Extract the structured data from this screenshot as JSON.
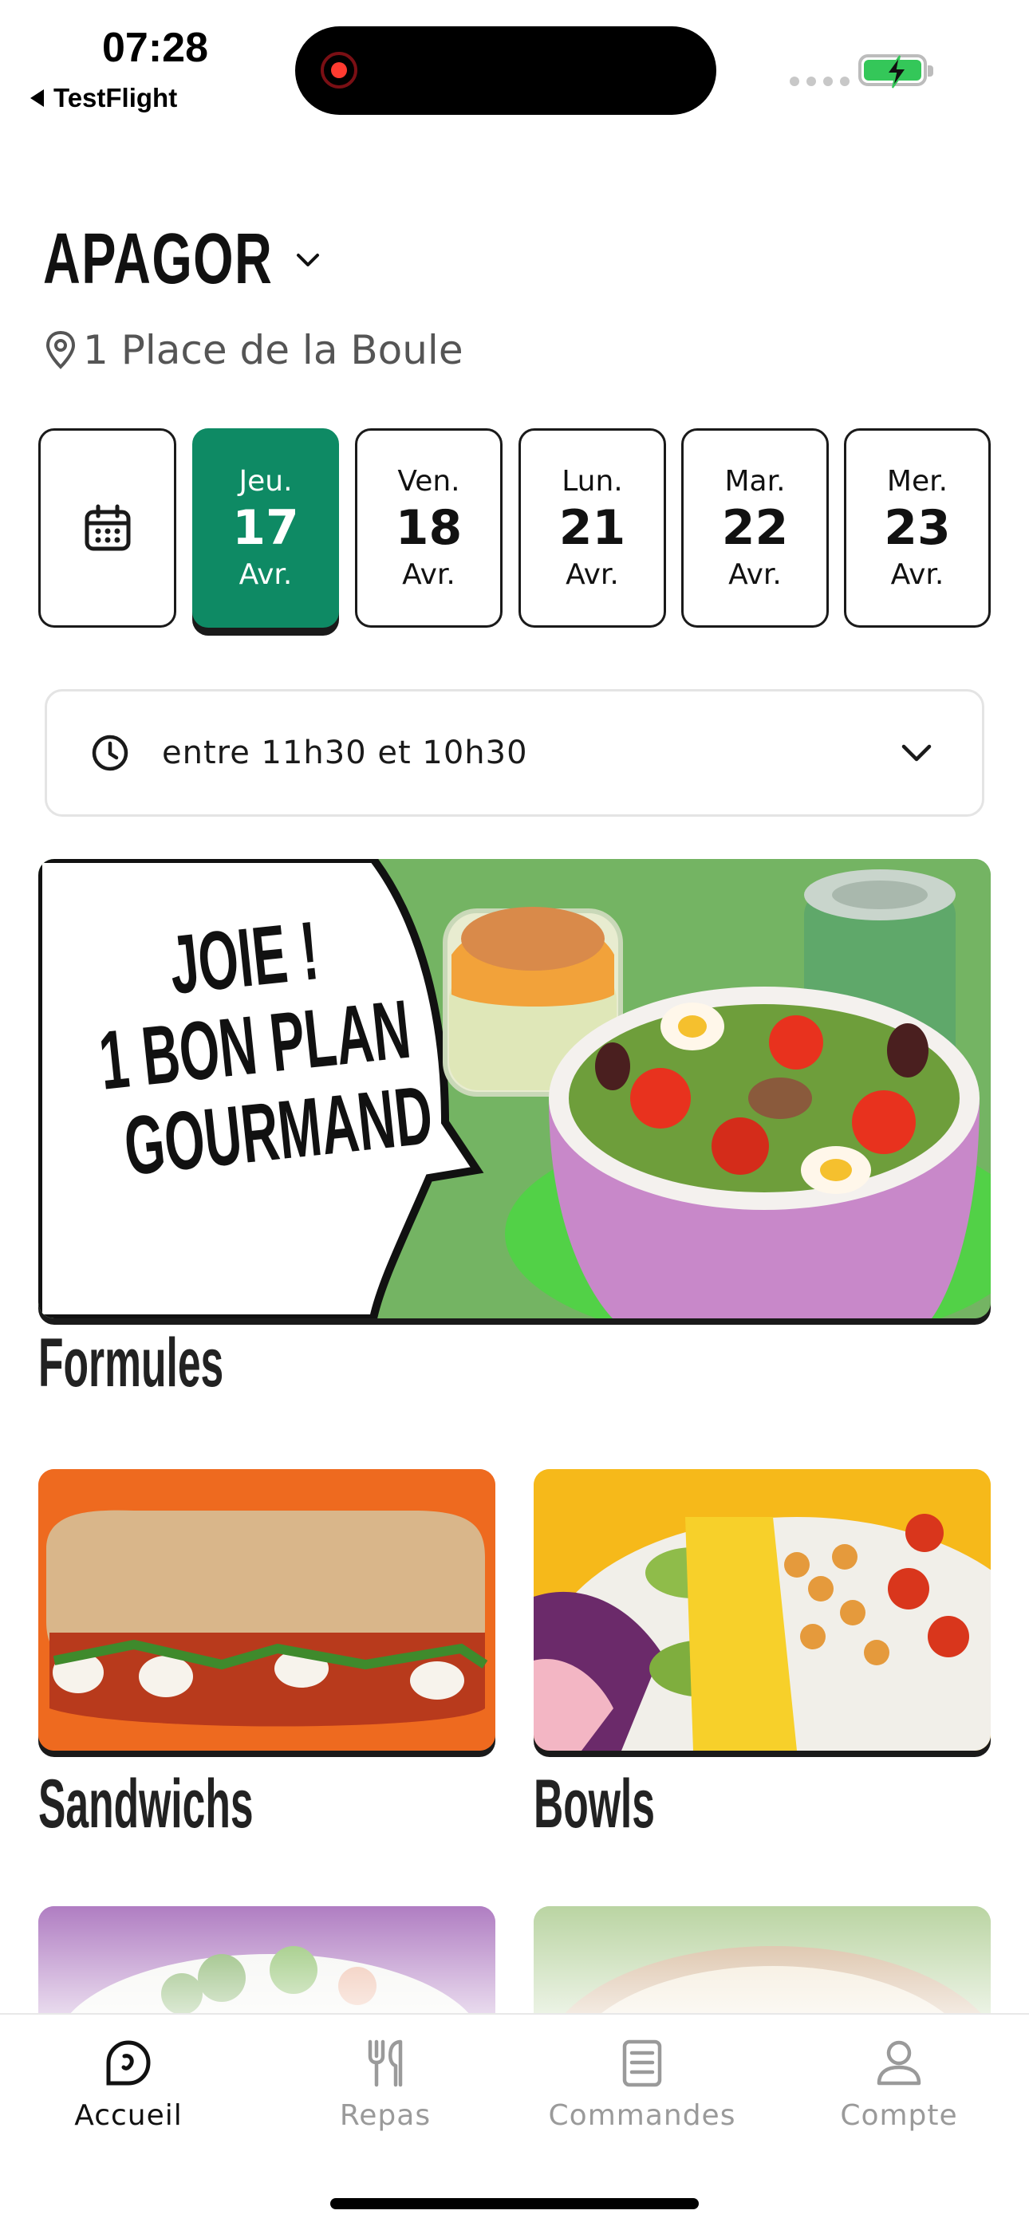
{
  "status_bar": {
    "time": "07:28",
    "back_label": "TestFlight"
  },
  "header": {
    "brand": "APAGOR",
    "address": "1 Place de la Boule"
  },
  "dates": [
    {
      "dow": "Jeu.",
      "day": "17",
      "month": "Avr.",
      "selected": true
    },
    {
      "dow": "Ven.",
      "day": "18",
      "month": "Avr.",
      "selected": false
    },
    {
      "dow": "Lun.",
      "day": "21",
      "month": "Avr.",
      "selected": false
    },
    {
      "dow": "Mar.",
      "day": "22",
      "month": "Avr.",
      "selected": false
    },
    {
      "dow": "Mer.",
      "day": "23",
      "month": "Avr.",
      "selected": false
    }
  ],
  "timeslot": {
    "value": "entre 11h30 et 10h30"
  },
  "promo": {
    "line1": "JOIE !",
    "line2": "1 BON PLAN",
    "line3": "GOURMAND"
  },
  "sections": {
    "formules_title": "Formules"
  },
  "categories": [
    {
      "label": "Sandwichs",
      "color": "#ee6a1f"
    },
    {
      "label": "Bowls",
      "color": "#f6b91a"
    },
    {
      "label": "",
      "color": "#9b5bb2"
    },
    {
      "label": "",
      "color": "#a8c98a"
    }
  ],
  "tabs": [
    {
      "label": "Accueil",
      "icon": "home-icon",
      "active": true
    },
    {
      "label": "Repas",
      "icon": "utensils-icon",
      "active": false
    },
    {
      "label": "Commandes",
      "icon": "receipt-icon",
      "active": false
    },
    {
      "label": "Compte",
      "icon": "user-icon",
      "active": false
    }
  ],
  "colors": {
    "accent": "#0e8a64",
    "inactive_tab": "#9a9a9a",
    "promo_green": "#74b463"
  }
}
